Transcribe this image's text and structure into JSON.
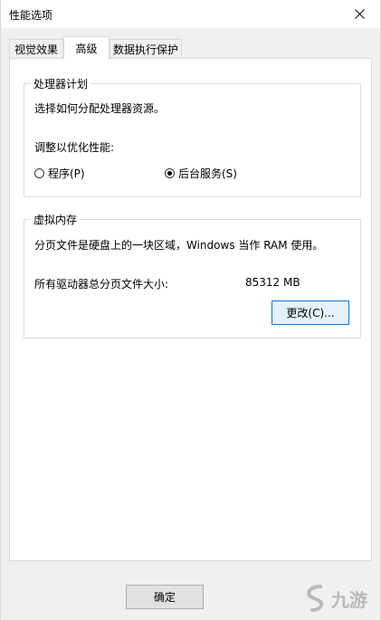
{
  "window": {
    "title": "性能选项"
  },
  "tabs": [
    {
      "label": "视觉效果",
      "active": false
    },
    {
      "label": "高级",
      "active": true
    },
    {
      "label": "数据执行保护",
      "active": false
    }
  ],
  "processor_group": {
    "title": "处理器计划",
    "description": "选择如何分配处理器资源。",
    "adjust_label": "调整以优化性能:",
    "options": [
      {
        "label": "程序(P)",
        "checked": false
      },
      {
        "label": "后台服务(S)",
        "checked": true
      }
    ]
  },
  "virtual_memory_group": {
    "title": "虚拟内存",
    "description": "分页文件是硬盘上的一块区域，Windows 当作 RAM 使用。",
    "total_label": "所有驱动器总分页文件大小:",
    "total_value": "85312 MB",
    "change_button": "更改(C)..."
  },
  "footer": {
    "ok_button": "确定"
  },
  "watermark": {
    "text": "九游"
  }
}
